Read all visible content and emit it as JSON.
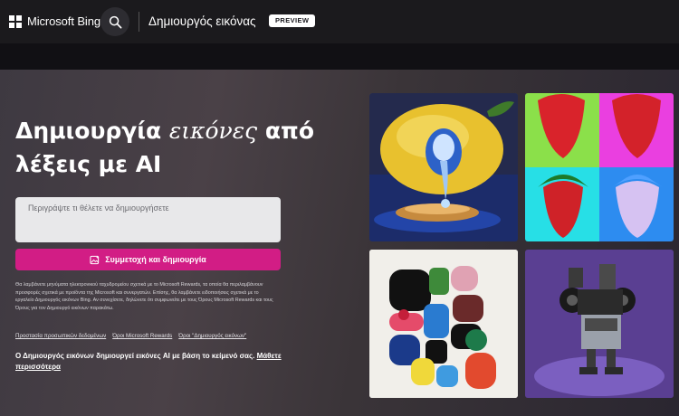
{
  "header": {
    "brand": "Microsoft Bing",
    "product_title": "Δημιουργός εικόνας",
    "badge": "PREVIEW"
  },
  "hero": {
    "headline_part1": "Δημιουργία ",
    "headline_italic": "εικόνες",
    "headline_part2": " από λέξεις με AI",
    "prompt_placeholder": "Περιγράψτε τι θέλετε να δημιουργήσετε",
    "join_button": "Συμμετοχή και δημιουργία",
    "legal_text": "Θα λαμβάνετε μηνύματα ηλεκτρονικού ταχυδρομείου σχετικά με το Microsoft Rewards, τα οποία θα περιλαμβάνουν προσφορές σχετικά με προϊόντα της Microsoft και συνεργατών. Επίσης, θα λαμβάνετε ειδοποιήσεις σχετικά με το εργαλείο Δημιουργός εικόνων Bing. Αν συνεχίσετε, δηλώνετε ότι συμφωνείτε με τους Όρους Microsoft Rewards και τους Όρους για τον Δημιουργό εικόνων παρακάτω.",
    "links": [
      "Προστασία προσωπικών δεδομένων",
      "Όροι Microsoft Rewards",
      "Όροι \"Δημιουργός εικόνων\""
    ],
    "footer_note": "Ο Δημιουργός εικόνων δημιουργεί εικόνες AI με βάση το κείμενό σας. ",
    "learn_more": "Μάθετε περισσότερα"
  },
  "icons": {
    "search": "search-icon",
    "image_create": "image-sparkle-icon"
  },
  "colors": {
    "accent": "#d21d85",
    "background": "#1b1a1f"
  }
}
